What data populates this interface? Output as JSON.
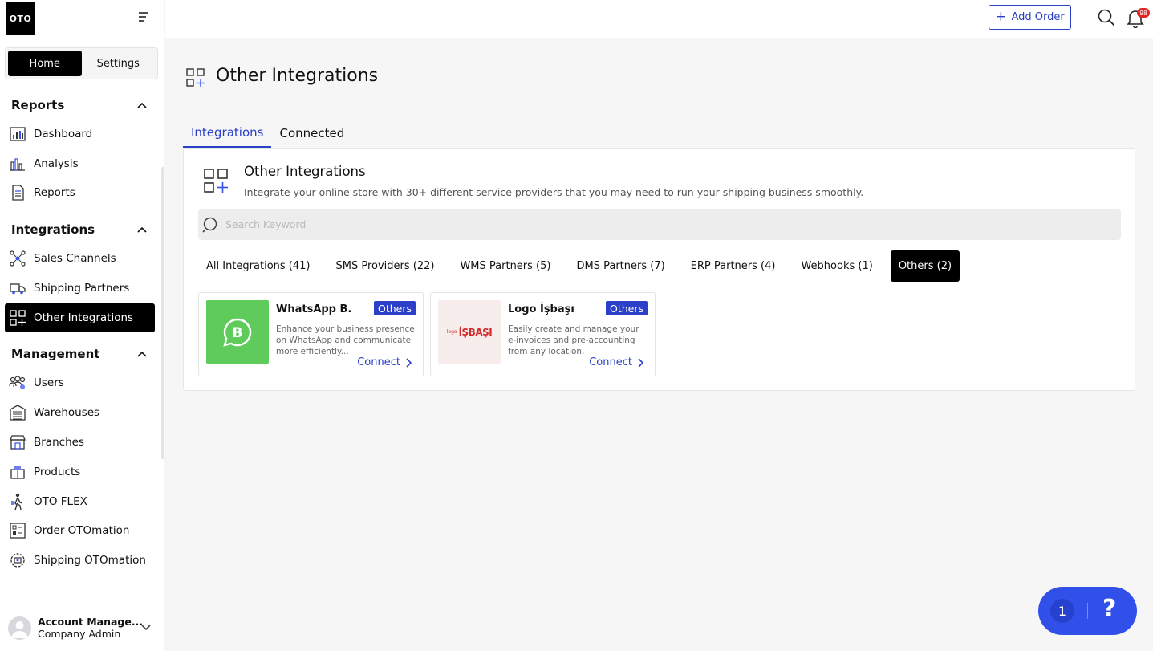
{
  "sidebar": {
    "logo": "OTO",
    "tabs": {
      "home": "Home",
      "settings": "Settings"
    },
    "sections": {
      "reports": {
        "title": "Reports",
        "items": [
          "Dashboard",
          "Analysis",
          "Reports"
        ]
      },
      "integrations": {
        "title": "Integrations",
        "items": [
          "Sales Channels",
          "Shipping Partners",
          "Other Integrations"
        ]
      },
      "management": {
        "title": "Management",
        "items": [
          "Users",
          "Warehouses",
          "Branches",
          "Products",
          "OTO FLEX",
          "Order OTOmation",
          "Shipping OTOmation"
        ]
      }
    },
    "account": {
      "name": "Account Manage...",
      "role": "Company Admin"
    }
  },
  "topbar": {
    "add_order": "Add Order",
    "notification_count": "98"
  },
  "page": {
    "title": "Other Integrations",
    "tabs": [
      "Integrations",
      "Connected"
    ]
  },
  "panel": {
    "title": "Other Integrations",
    "subtitle": "Integrate your online store with 30+ different service providers that you may need to run your shipping business smoothly.",
    "search_placeholder": "Search Keyword",
    "filters": [
      "All Integrations (41)",
      "SMS Providers (22)",
      "WMS Partners (5)",
      "DMS Partners (7)",
      "ERP Partners (4)",
      "Webhooks (1)",
      "Others (2)"
    ],
    "cards": [
      {
        "name": "WhatsApp B.",
        "badge": "Others",
        "description": "Enhance your business presence on WhatsApp and communicate more efficiently...",
        "action": "Connect"
      },
      {
        "name": "Logo İşbaşı",
        "badge": "Others",
        "description": "Easily create and manage your e-invoices and pre-accounting from any location.",
        "action": "Connect",
        "logo_text": "İŞBAŞI",
        "logo_small": "logo"
      }
    ]
  },
  "help": {
    "count": "1",
    "symbol": "?"
  },
  "colors": {
    "accent": "#2b3fc8",
    "whatsapp": "#5ecb5a",
    "logo_red": "#d42a2a"
  }
}
